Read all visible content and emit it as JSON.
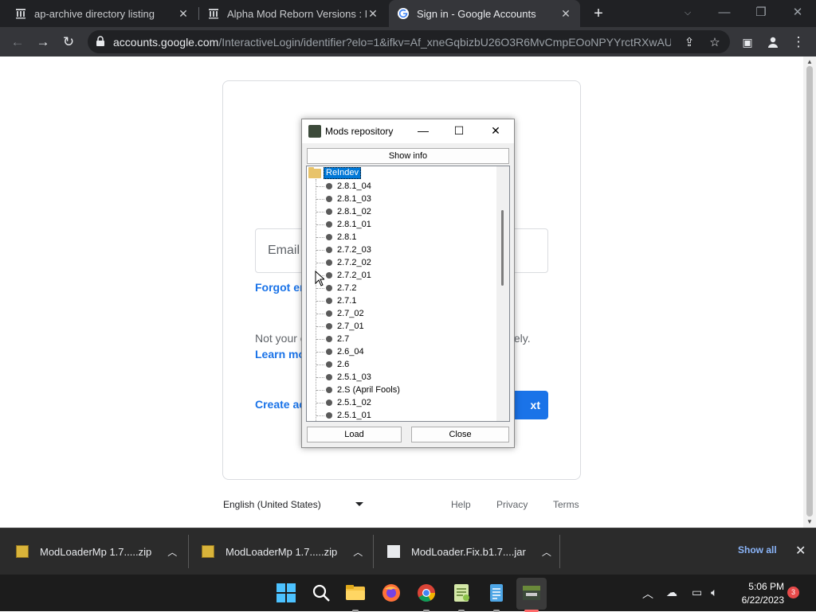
{
  "browser": {
    "tabs": [
      {
        "label": "ap-archive directory listing",
        "icon": "archive-icon"
      },
      {
        "label": "Alpha Mod Reborn Versions : Mr",
        "icon": "archive-icon"
      },
      {
        "label": "Sign in - Google Accounts",
        "icon": "google-icon",
        "active": true
      }
    ],
    "url_host": "accounts.google.com",
    "url_path": "/InteractiveLogin/identifier?elo=1&ifkv=Af_xneGqbizbU26O3R6MvCmpEOoNPYYrctRXwAU..."
  },
  "signin": {
    "email_label": "Email",
    "forgot_label": "Forgot em",
    "not_your": "Not your c",
    "privately": "tely.",
    "learn_more": "Learn mo",
    "create_account": "Create ac",
    "next_label": "xt"
  },
  "footer": {
    "language": "English (United States)",
    "help": "Help",
    "privacy": "Privacy",
    "terms": "Terms"
  },
  "dialog": {
    "title": "Mods repository",
    "show_info": "Show info",
    "load": "Load",
    "close": "Close",
    "root": "ReIndev",
    "items": [
      "2.8.1_04",
      "2.8.1_03",
      "2.8.1_02",
      "2.8.1_01",
      "2.8.1",
      "2.7.2_03",
      "2.7.2_02",
      "2.7.2_01",
      "2.7.2",
      "2.7.1",
      "2.7_02",
      "2.7_01",
      "2.7",
      "2.6_04",
      "2.6",
      "2.5.1_03",
      "2.S (April Fools)",
      "2.5.1_02",
      "2.5.1_01"
    ]
  },
  "downloads": {
    "items": [
      {
        "name": "ModLoaderMp 1.7.....zip",
        "type": "zip"
      },
      {
        "name": "ModLoaderMp 1.7.....zip",
        "type": "zip"
      },
      {
        "name": "ModLoader.Fix.b1.7....jar",
        "type": "jar"
      }
    ],
    "show_all": "Show all"
  },
  "taskbar": {
    "time": "5:06 PM",
    "date": "6/22/2023",
    "notification_count": "3"
  },
  "colors": {
    "accent": "#1a73e8",
    "chrome_dark": "#202124",
    "selection": "#0078d7"
  }
}
